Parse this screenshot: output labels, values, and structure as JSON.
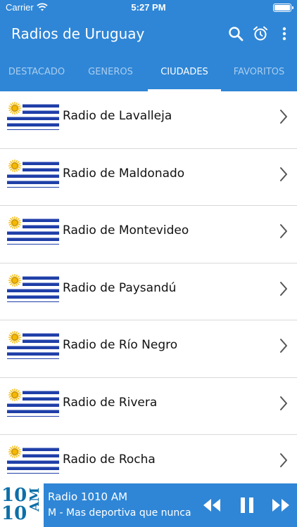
{
  "status_bar": {
    "carrier": "Carrier",
    "time": "5:27 PM"
  },
  "app_bar": {
    "title": "Radios de Uruguay"
  },
  "tabs": [
    {
      "label": "DESTACADO",
      "active": false
    },
    {
      "label": "GENEROS",
      "active": false
    },
    {
      "label": "CIUDADES",
      "active": true
    },
    {
      "label": "FAVORITOS",
      "active": false
    }
  ],
  "cities": [
    {
      "label": "Radio de Lavalleja"
    },
    {
      "label": "Radio de Maldonado"
    },
    {
      "label": "Radio de Montevideo"
    },
    {
      "label": "Radio de Paysandú"
    },
    {
      "label": "Radio de Río Negro"
    },
    {
      "label": "Radio de Rivera"
    },
    {
      "label": "Radio de Rocha"
    }
  ],
  "player": {
    "logo_line1": "10",
    "logo_line2": "10",
    "logo_am": "AM",
    "station": "Radio 1010 AM",
    "now_playing": "M - Mas deportiva que nunca MU"
  },
  "colors": {
    "primary": "#2f86d6",
    "flag_blue": "#1f3fa8",
    "sun": "#f5b800"
  }
}
